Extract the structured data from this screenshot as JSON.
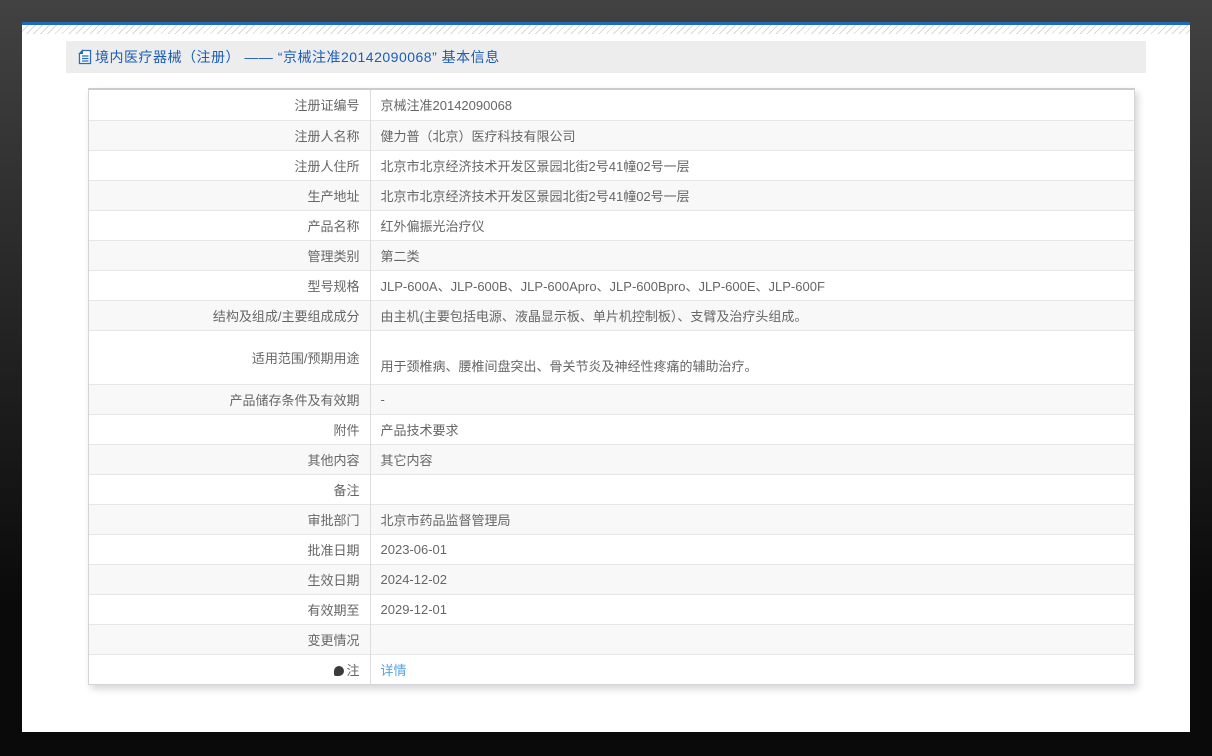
{
  "page": {
    "accent_line_color": "#1e6bb8",
    "outer_background_top": "#424242",
    "outer_background_bottom": "#0a0a0a",
    "panel_background": "#ffffff"
  },
  "header": {
    "icon": "document-icon",
    "icon_color": "#2a6abf",
    "title": "境内医疗器械（注册） —— “京械注准20142090068” 基本信息",
    "title_color": "#1b5cb8",
    "band_background": "#ededed"
  },
  "table": {
    "label_column_header": "",
    "stripe_color": "#f8f8f8",
    "border_color": "#e6e6e6",
    "text_color": "#666666",
    "link_color": "#55a1e4",
    "rows": [
      {
        "label": "注册证编号",
        "value": "京械注准20142090068"
      },
      {
        "label": "注册人名称",
        "value": "健力普（北京）医疗科技有限公司"
      },
      {
        "label": "注册人住所",
        "value": "北京市北京经济技术开发区景园北街2号41幢02号一层"
      },
      {
        "label": "生产地址",
        "value": "北京市北京经济技术开发区景园北街2号41幢02号一层"
      },
      {
        "label": "产品名称",
        "value": "红外偏振光治疗仪"
      },
      {
        "label": "管理类别",
        "value": "第二类"
      },
      {
        "label": "型号规格",
        "value": "JLP-600A、JLP-600B、JLP-600Apro、JLP-600Bpro、JLP-600E、JLP-600F"
      },
      {
        "label": "结构及组成/主要组成成分",
        "value": "由主机(主要包括电源、液晶显示板、单片机控制板）、支臂及治疗头组成。"
      },
      {
        "label": "适用范围/预期用途",
        "value": "用于颈椎病、腰椎间盘突出、骨关节炎及神经性疼痛的辅助治疗。",
        "tall": true
      },
      {
        "label": "产品储存条件及有效期",
        "value": "-"
      },
      {
        "label": "附件",
        "value": "产品技术要求"
      },
      {
        "label": "其他内容",
        "value": "其它内容"
      },
      {
        "label": "备注",
        "value": ""
      },
      {
        "label": "审批部门",
        "value": "北京市药品监督管理局"
      },
      {
        "label": "批准日期",
        "value": "2023-06-01"
      },
      {
        "label": "生效日期",
        "value": "2024-12-02"
      },
      {
        "label": "有效期至",
        "value": "2029-12-01"
      },
      {
        "label": "变更情况",
        "value": ""
      },
      {
        "label": "注",
        "icon": "note-balloon-icon",
        "link": "详情"
      }
    ]
  }
}
